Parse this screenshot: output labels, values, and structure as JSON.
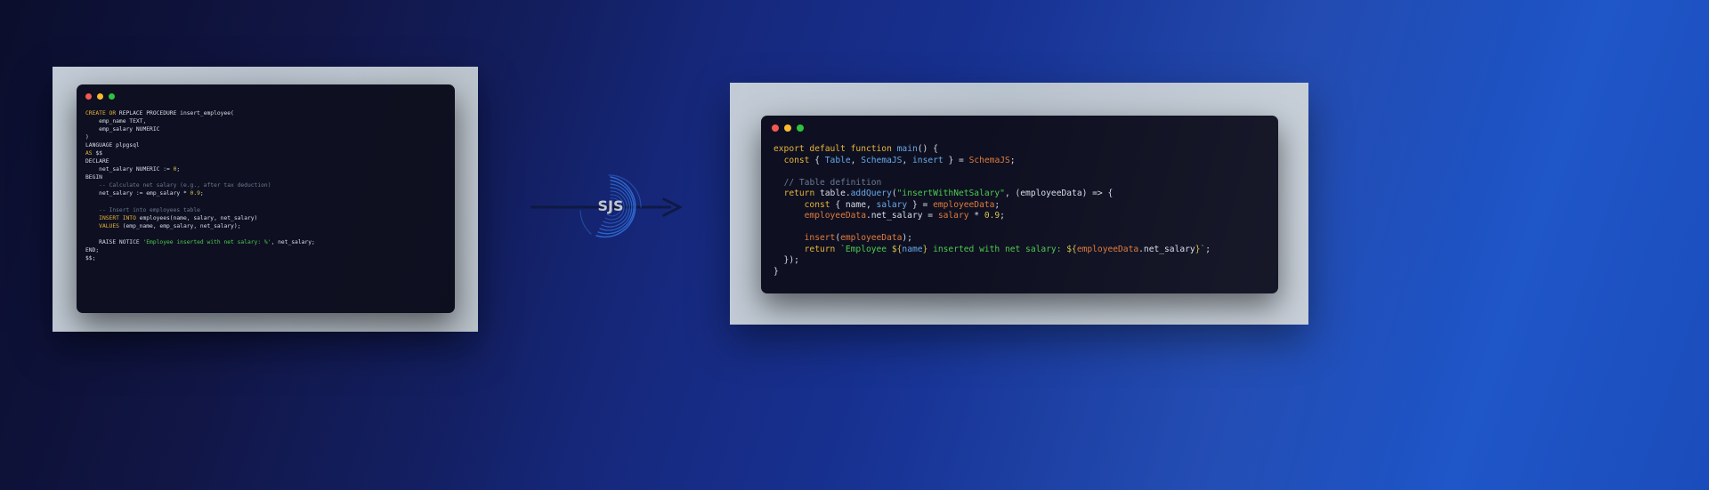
{
  "background": {
    "gradient_from": "#0b0e2c",
    "gradient_to": "#1f56c8"
  },
  "left_terminal": {
    "name": "sql-procedure-terminal",
    "language": "plpgsql",
    "traffic_lights": [
      "close",
      "minimize",
      "maximize"
    ],
    "colors": {
      "close": "#f4594f",
      "minimize": "#f6bb2f",
      "maximize": "#2fc23e",
      "background": "#0e1021"
    },
    "lines": [
      [
        {
          "t": "CREATE OR",
          "c": "kw"
        },
        {
          "t": " REPLACE PROCEDURE insert_employee(",
          "c": "plain"
        }
      ],
      [
        {
          "t": "    emp_name TEXT,",
          "c": "plain"
        }
      ],
      [
        {
          "t": "    emp_salary NUMERIC",
          "c": "plain"
        }
      ],
      [
        {
          "t": ")",
          "c": "plain"
        }
      ],
      [
        {
          "t": "LANGUAGE plpgsql",
          "c": "plain"
        }
      ],
      [
        {
          "t": "AS",
          "c": "kw"
        },
        {
          "t": " $$",
          "c": "plain"
        }
      ],
      [
        {
          "t": "DECLARE",
          "c": "plain"
        }
      ],
      [
        {
          "t": "    net_salary NUMERIC := ",
          "c": "plain"
        },
        {
          "t": "0",
          "c": "num"
        },
        {
          "t": ";",
          "c": "plain"
        }
      ],
      [
        {
          "t": "BEGIN",
          "c": "plain"
        }
      ],
      [
        {
          "t": "    -- Calculate net salary (e.g., after tax deduction)",
          "c": "cm"
        }
      ],
      [
        {
          "t": "    net_salary := emp_salary * ",
          "c": "plain"
        },
        {
          "t": "0.9",
          "c": "num"
        },
        {
          "t": ";",
          "c": "plain"
        }
      ],
      [
        {
          "t": "",
          "c": "plain"
        }
      ],
      [
        {
          "t": "    -- Insert into employees table",
          "c": "cm"
        }
      ],
      [
        {
          "t": "    ",
          "c": "plain"
        },
        {
          "t": "INSERT INTO",
          "c": "kw"
        },
        {
          "t": " employees(name, salary, net_salary)",
          "c": "plain"
        }
      ],
      [
        {
          "t": "    ",
          "c": "plain"
        },
        {
          "t": "VALUES",
          "c": "kw"
        },
        {
          "t": " (emp_name, emp_salary, net_salary);",
          "c": "plain"
        }
      ],
      [
        {
          "t": "",
          "c": "plain"
        }
      ],
      [
        {
          "t": "    RAISE NOTICE ",
          "c": "plain"
        },
        {
          "t": "'Employee inserted with net salary: %'",
          "c": "str"
        },
        {
          "t": ", net_salary;",
          "c": "plain"
        }
      ],
      [
        {
          "t": "END;",
          "c": "plain"
        }
      ],
      [
        {
          "t": "$$;",
          "c": "plain"
        }
      ]
    ]
  },
  "right_terminal": {
    "name": "javascript-schemajs-terminal",
    "language": "javascript",
    "traffic_lights": [
      "close",
      "minimize",
      "maximize"
    ],
    "colors": {
      "close": "#f4594f",
      "minimize": "#f6bb2f",
      "maximize": "#2fc23e",
      "background": "#0e1021"
    },
    "lines": [
      [
        {
          "t": "export default function",
          "c": "kw"
        },
        {
          "t": " ",
          "c": "plain"
        },
        {
          "t": "main",
          "c": "fn"
        },
        {
          "t": "() {",
          "c": "plain"
        }
      ],
      [
        {
          "t": "  ",
          "c": "plain"
        },
        {
          "t": "const",
          "c": "kw"
        },
        {
          "t": " { ",
          "c": "plain"
        },
        {
          "t": "Table",
          "c": "fn"
        },
        {
          "t": ", ",
          "c": "plain"
        },
        {
          "t": "SchemaJS",
          "c": "fn"
        },
        {
          "t": ", ",
          "c": "plain"
        },
        {
          "t": "insert",
          "c": "fn"
        },
        {
          "t": " } = ",
          "c": "plain"
        },
        {
          "t": "SchemaJS",
          "c": "var"
        },
        {
          "t": ";",
          "c": "plain"
        }
      ],
      [
        {
          "t": "",
          "c": "plain"
        }
      ],
      [
        {
          "t": "  ",
          "c": "plain"
        },
        {
          "t": "// Table definition",
          "c": "cm"
        }
      ],
      [
        {
          "t": "  ",
          "c": "plain"
        },
        {
          "t": "return",
          "c": "kw"
        },
        {
          "t": " table",
          "c": "plain"
        },
        {
          "t": ".",
          "c": "plain"
        },
        {
          "t": "addQuery",
          "c": "fn"
        },
        {
          "t": "(",
          "c": "plain"
        },
        {
          "t": "\"insertWithNetSalary\"",
          "c": "str"
        },
        {
          "t": ", (employeeData) => {",
          "c": "plain"
        }
      ],
      [
        {
          "t": "      ",
          "c": "plain"
        },
        {
          "t": "const",
          "c": "kw"
        },
        {
          "t": " { ",
          "c": "plain"
        },
        {
          "t": "name",
          "c": "plain"
        },
        {
          "t": ", ",
          "c": "plain"
        },
        {
          "t": "salary",
          "c": "fn"
        },
        {
          "t": " } = ",
          "c": "plain"
        },
        {
          "t": "employeeData",
          "c": "var"
        },
        {
          "t": ";",
          "c": "plain"
        }
      ],
      [
        {
          "t": "      ",
          "c": "plain"
        },
        {
          "t": "employeeData",
          "c": "var"
        },
        {
          "t": ".net_salary = ",
          "c": "plain"
        },
        {
          "t": "salary",
          "c": "var"
        },
        {
          "t": " * ",
          "c": "plain"
        },
        {
          "t": "0.9",
          "c": "num"
        },
        {
          "t": ";",
          "c": "plain"
        }
      ],
      [
        {
          "t": "",
          "c": "plain"
        }
      ],
      [
        {
          "t": "      ",
          "c": "plain"
        },
        {
          "t": "insert",
          "c": "var"
        },
        {
          "t": "(",
          "c": "plain"
        },
        {
          "t": "employeeData",
          "c": "var"
        },
        {
          "t": ");",
          "c": "plain"
        }
      ],
      [
        {
          "t": "      ",
          "c": "plain"
        },
        {
          "t": "return",
          "c": "kw"
        },
        {
          "t": " ",
          "c": "plain"
        },
        {
          "t": "`Employee ",
          "c": "str"
        },
        {
          "t": "${",
          "c": "num"
        },
        {
          "t": "name",
          "c": "fn"
        },
        {
          "t": "}",
          "c": "num"
        },
        {
          "t": " inserted with net salary: ",
          "c": "str"
        },
        {
          "t": "${",
          "c": "num"
        },
        {
          "t": "employeeData",
          "c": "var"
        },
        {
          "t": ".net_salary",
          "c": "plain"
        },
        {
          "t": "}",
          "c": "num"
        },
        {
          "t": "`",
          "c": "str"
        },
        {
          "t": ";",
          "c": "plain"
        }
      ],
      [
        {
          "t": "  });",
          "c": "plain"
        }
      ],
      [
        {
          "t": "}",
          "c": "plain"
        }
      ]
    ]
  },
  "connector": {
    "name": "transformation-arrow",
    "arrow_color": "#0e1a45",
    "logo_text": "SJS",
    "logo_text_color": "#c8ccd4",
    "logo_ring_color": "#2f6fd8"
  }
}
